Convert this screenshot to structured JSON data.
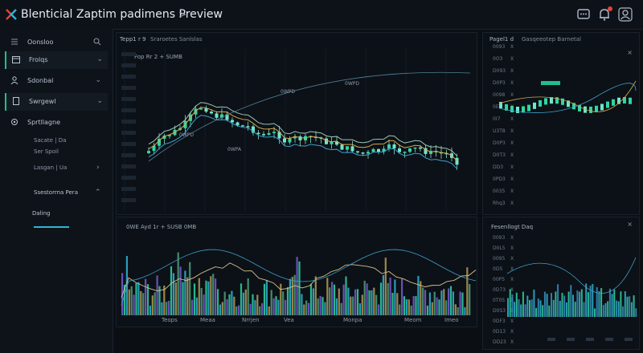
{
  "app": {
    "title": "Blenticial Zaptim padimens Preview",
    "chevron": ">"
  },
  "titlebar_icons": [
    "chat-icon",
    "bell-icon",
    "user-icon"
  ],
  "sidebar": {
    "search_label": "Oonsloo",
    "items": [
      {
        "label": "Frolqs",
        "icon": "calendar-icon"
      },
      {
        "label": "Sdonbal",
        "icon": "user-icon"
      },
      {
        "label": "Swrgewl",
        "icon": "doc-icon"
      },
      {
        "label": "Sprtllagne",
        "icon": "gear-icon"
      }
    ],
    "sub_items": [
      "Sacate  |  Da",
      "Ser Spoil",
      "Lasgan  |  Ua",
      "Ssestorrna Pera",
      "Daling"
    ]
  },
  "main_chart": {
    "header": "Tepp1 r 9",
    "header_tabs": "Sraroetes   Sanlslas",
    "legend": "Fop Rr   2  +  SUMB",
    "labels": [
      "0WPD",
      "0WPD",
      "0WPD",
      "0WPA"
    ]
  },
  "volume_chart": {
    "legend": "0WE  Ayd 1r   +  SUSB 0MB",
    "x_labels": [
      "Teops",
      "Meaa",
      "Nrrjen",
      "Vea",
      "Monpa",
      "Meom",
      "Imeo"
    ]
  },
  "right_top": {
    "header": "Pagel1 d",
    "tabs": "Gasqeeotep  Barnetal",
    "rows": [
      "0093",
      "0O3",
      "D093",
      "D0P3",
      "0098",
      "0E0",
      "0I7",
      "U3T8",
      "D0P3",
      "D0T3",
      "DD3",
      "0PD3",
      "0035",
      "Rhq3"
    ]
  },
  "right_bottom": {
    "header": "Fesenllogt Daq",
    "rows": [
      "0093",
      "D0L5",
      "0095",
      "0D5",
      "00P5",
      "0D73",
      "0T0S",
      "D0S3",
      "0DF3",
      "0D13",
      "DD23"
    ]
  },
  "colors": {
    "accent": "#1fbf8f",
    "bull": "#2fd6a2",
    "bear": "#5ce1c7",
    "blue": "#2fb5d6",
    "purple": "#7b5bd6"
  }
}
